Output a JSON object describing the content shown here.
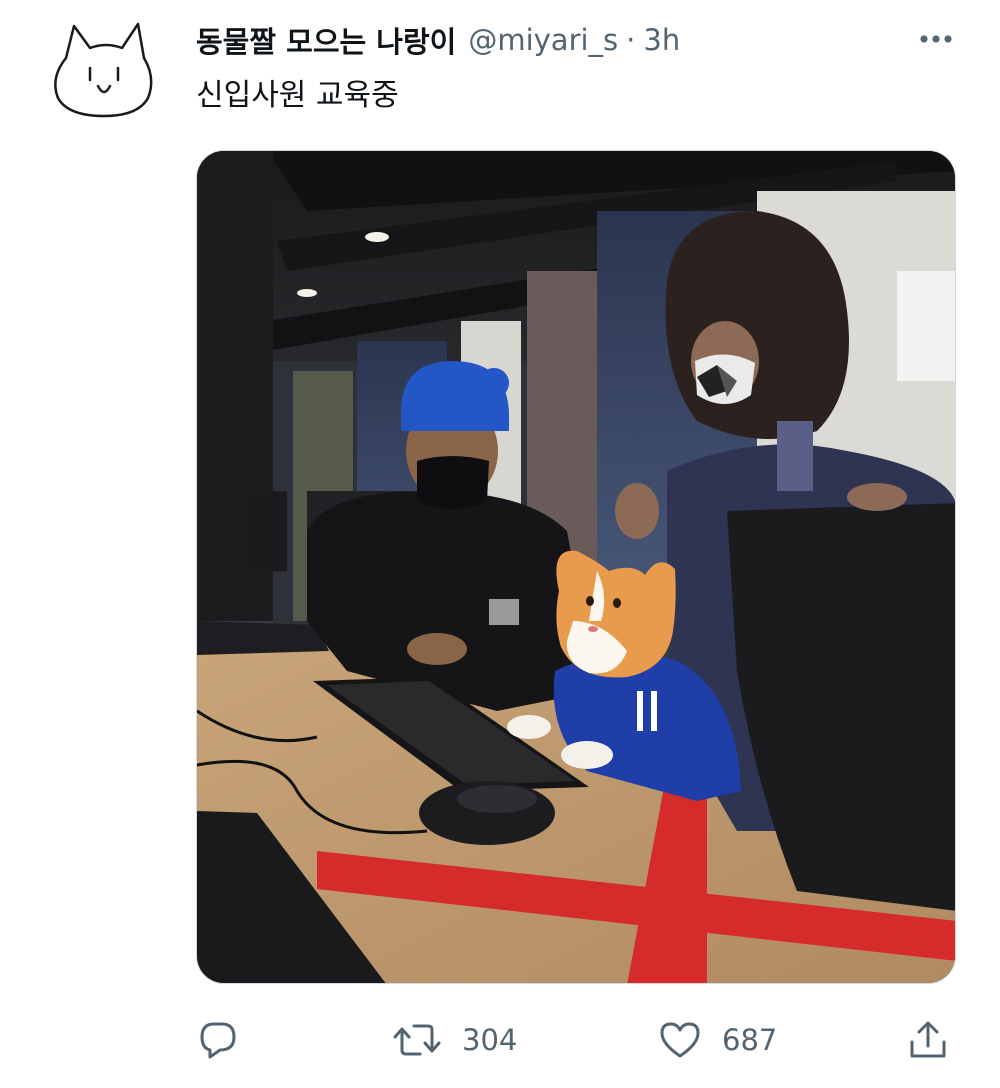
{
  "tweet": {
    "author": {
      "display_name": "동물짤 모으는 나랑이",
      "handle": "@miyari_s",
      "separator": "·",
      "time": "3h"
    },
    "text": "신입사원 교육중",
    "actions": {
      "reply": {
        "icon": "reply-icon"
      },
      "retweet": {
        "icon": "retweet-icon",
        "count": "304"
      },
      "like": {
        "icon": "heart-icon",
        "count": "687"
      },
      "share": {
        "icon": "share-icon"
      }
    },
    "more_icon": "more-horizontal-icon"
  },
  "colors": {
    "text_primary": "#0f1419",
    "text_secondary": "#536471",
    "border": "#cfd9de"
  }
}
